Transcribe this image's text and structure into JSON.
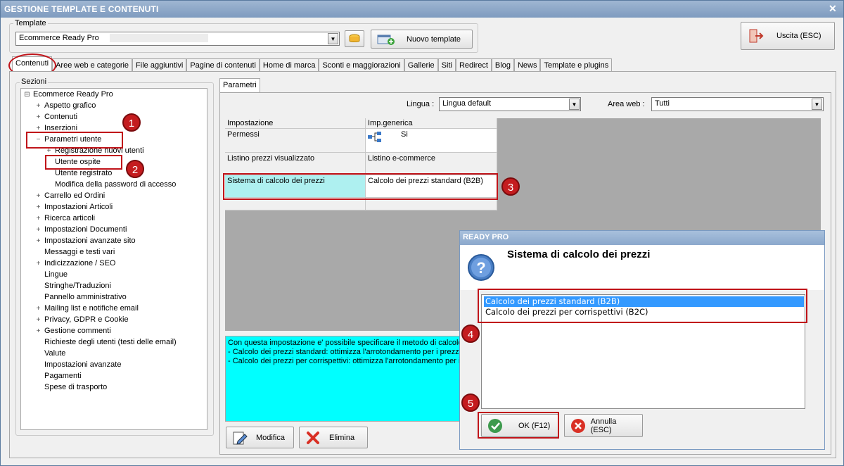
{
  "window": {
    "title": "GESTIONE TEMPLATE E CONTENUTI"
  },
  "template": {
    "label": "Template",
    "value": "Ecommerce Ready Pro",
    "new_button": "Nuovo template"
  },
  "exit_button": "Uscita (ESC)",
  "tabs": [
    {
      "label": "Contenuti"
    },
    {
      "label": "Aree web e categorie"
    },
    {
      "label": "File aggiuntivi"
    },
    {
      "label": "Pagine di contenuti"
    },
    {
      "label": "Home di marca"
    },
    {
      "label": "Sconti e maggiorazioni"
    },
    {
      "label": "Gallerie"
    },
    {
      "label": "Siti"
    },
    {
      "label": "Redirect"
    },
    {
      "label": "Blog"
    },
    {
      "label": "News"
    },
    {
      "label": "Template e plugins"
    }
  ],
  "sections": {
    "label": "Sezioni",
    "tree": [
      {
        "label": "Ecommerce Ready Pro",
        "exp": "⊟"
      },
      {
        "label": "Aspetto grafico",
        "exp": "+"
      },
      {
        "label": "Contenuti",
        "exp": "+"
      },
      {
        "label": "Inserzioni",
        "exp": "+"
      },
      {
        "label": "Parametri utente",
        "exp": "−"
      },
      {
        "label": "Registrazione nuovi utenti",
        "exp": "+"
      },
      {
        "label": "Utente ospite",
        "exp": ""
      },
      {
        "label": "Utente registrato",
        "exp": ""
      },
      {
        "label": "Modifica della password di accesso",
        "exp": ""
      },
      {
        "label": "Carrello ed Ordini",
        "exp": "+"
      },
      {
        "label": "Impostazioni Articoli",
        "exp": "+"
      },
      {
        "label": "Ricerca articoli",
        "exp": "+"
      },
      {
        "label": "Impostazioni Documenti",
        "exp": "+"
      },
      {
        "label": "Impostazioni avanzate sito",
        "exp": "+"
      },
      {
        "label": "Messaggi e testi vari",
        "exp": ""
      },
      {
        "label": "Indicizzazione / SEO",
        "exp": "+"
      },
      {
        "label": "Lingue",
        "exp": ""
      },
      {
        "label": "Stringhe/Traduzioni",
        "exp": ""
      },
      {
        "label": "Pannello amministrativo",
        "exp": ""
      },
      {
        "label": "Mailing list e notifiche email",
        "exp": "+"
      },
      {
        "label": "Privacy, GDPR e Cookie",
        "exp": "+"
      },
      {
        "label": "Gestione commenti",
        "exp": "+"
      },
      {
        "label": "Richieste degli utenti (testi delle email)",
        "exp": ""
      },
      {
        "label": "Valute",
        "exp": ""
      },
      {
        "label": "Impostazioni avanzate",
        "exp": ""
      },
      {
        "label": "Pagamenti",
        "exp": ""
      },
      {
        "label": "Spese di trasporto",
        "exp": ""
      }
    ]
  },
  "params": {
    "tab": "Parametri",
    "lingua_label": "Lingua :",
    "lingua_value": "Lingua default",
    "area_label": "Area web :",
    "area_value": "Tutti",
    "col1": "Impostazione",
    "col2": "Imp.generica",
    "rows": [
      {
        "name": "Permessi",
        "value": "Si"
      },
      {
        "name": "Listino prezzi visualizzato",
        "value": "Listino e-commerce"
      },
      {
        "name": "Sistema di calcolo dei prezzi",
        "value": "Calcolo dei prezzi standard (B2B)"
      }
    ],
    "description": [
      "Con questa impostazione e' possibile specificare il metodo di calcolo de",
      "- Calcolo dei prezzi standard: ottimizza l'arrotondamento per i prezzi in",
      "- Calcolo dei prezzi per corrispettivi: ottimizza l'arrotondamento per i p"
    ],
    "modify_button": "Modifica",
    "delete_button": "Elimina"
  },
  "dialog": {
    "title": "READY PRO",
    "heading": "Sistema di calcolo dei prezzi",
    "options": [
      "Calcolo dei prezzi standard (B2B)",
      "Calcolo dei prezzi per corrispettivi (B2C)"
    ],
    "ok_button": "OK (F12)",
    "cancel_button": "Annulla (ESC)"
  },
  "badges": [
    "1",
    "2",
    "3",
    "4",
    "5"
  ],
  "colors": {
    "highlight": "#c0141a",
    "selection": "#3399ff",
    "description_bg": "#00ffff",
    "setting_bg": "#aef0f0"
  }
}
